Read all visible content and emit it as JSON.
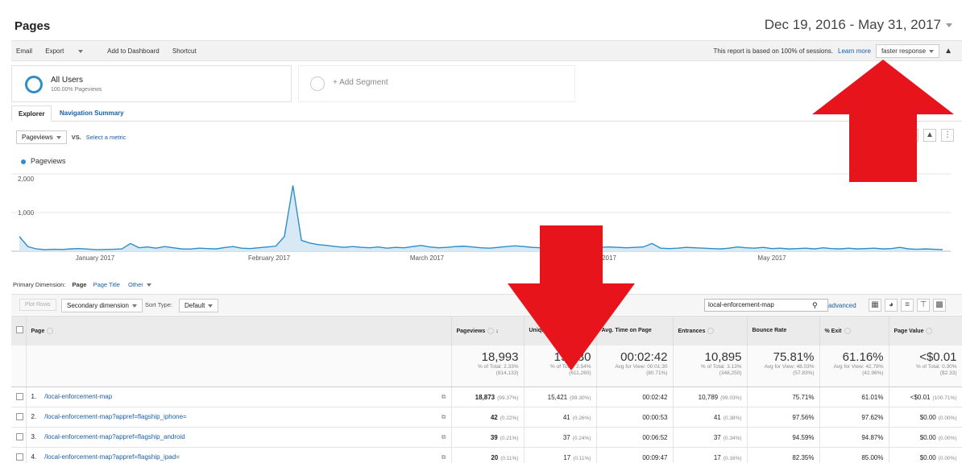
{
  "header": {
    "title": "Pages",
    "date_range": "Dec 19, 2016 - May 31, 2017"
  },
  "toolbar": {
    "email": "Email",
    "export": "Export",
    "add_dashboard": "Add to Dashboard",
    "shortcut": "Shortcut",
    "sampling_note": "This report is based on 100% of sessions.",
    "learn_more": "Learn more",
    "response_select": "faster response"
  },
  "segments": {
    "all_users": {
      "name": "All Users",
      "sub": "100.00% Pageviews"
    },
    "add_segment": "+ Add Segment"
  },
  "tabs": {
    "explorer": "Explorer",
    "navigation_summary": "Navigation Summary"
  },
  "metric_bar": {
    "metric": "Pageviews",
    "vs": "VS.",
    "select_metric": "Select a metric"
  },
  "chart_legend": "Pageviews",
  "chart_data": {
    "type": "area",
    "series": [
      {
        "name": "Pageviews",
        "color": "#2f8ec6",
        "values": [
          380,
          120,
          60,
          40,
          50,
          45,
          60,
          70,
          55,
          40,
          45,
          50,
          60,
          200,
          90,
          110,
          80,
          120,
          90,
          60,
          55,
          80,
          70,
          60,
          95,
          120,
          80,
          70,
          90,
          110,
          130,
          380,
          1700,
          280,
          210,
          170,
          150,
          120,
          100,
          120,
          100,
          90,
          110,
          80,
          100,
          90,
          120,
          150,
          110,
          90,
          100,
          120,
          130,
          110,
          90,
          80,
          100,
          120,
          140,
          120,
          100,
          90,
          110,
          130,
          120,
          100,
          80,
          90,
          100,
          110,
          100,
          90,
          100,
          110,
          200,
          80,
          70,
          80,
          100,
          90,
          80,
          70,
          60,
          80,
          110,
          90,
          80,
          100,
          70,
          80,
          60,
          70,
          80,
          60,
          90,
          70,
          60,
          80,
          60,
          70,
          80,
          60,
          70,
          100,
          60,
          50,
          60,
          50,
          40
        ]
      }
    ],
    "ylim": [
      0,
      2000
    ],
    "y_ticks": [
      "2,000",
      "1,000"
    ],
    "x_ticks": [
      "January 2017",
      "February 2017",
      "March 2017",
      "2017",
      "May 2017"
    ]
  },
  "primary_dimension": {
    "label": "Primary Dimension:",
    "current": "Page",
    "page_title": "Page Title",
    "other": "Other"
  },
  "table_controls": {
    "plot_rows": "Plot Rows",
    "secondary_dimension": "Secondary dimension",
    "sort_type_label": "Sort Type:",
    "sort_type": "Default",
    "search_value": "local-enforcement-map",
    "advanced": "advanced"
  },
  "table": {
    "headers": [
      "Page",
      "Pageviews",
      "Unique",
      "Avg. Time on Page",
      "Entrances",
      "Bounce Rate",
      "% Exit",
      "Page Value"
    ],
    "totals": [
      {
        "value": "18,993",
        "sub": "% of Total: 2.33%",
        "sub2": "(814,133)"
      },
      {
        "value": "15,530",
        "sub": "% of Total: 2.54%",
        "sub2": "(611,260)"
      },
      {
        "value": "00:02:42",
        "sub": "Avg for View: 00:01:30",
        "sub2": "(80.71%)"
      },
      {
        "value": "10,895",
        "sub": "% of Total: 3.13%",
        "sub2": "(348,250)"
      },
      {
        "value": "75.81%",
        "sub": "Avg for View: 48.03%",
        "sub2": "(57.83%)"
      },
      {
        "value": "61.16%",
        "sub": "Avg for View: 42.78%",
        "sub2": "(42.96%)"
      },
      {
        "value": "<$0.01",
        "sub": "% of Total: 0.30%",
        "sub2": "($2.33)"
      }
    ],
    "rows": [
      {
        "idx": "1.",
        "page": "/local-enforcement-map",
        "pv": "18,873",
        "pvp": "(99.37%)",
        "u": "15,421",
        "up": "(99.30%)",
        "t": "00:02:42",
        "e": "10,789",
        "ep": "(99.03%)",
        "b": "75.71%",
        "x": "61.01%",
        "v": "<$0.01",
        "vp": "(100.71%)"
      },
      {
        "idx": "2.",
        "page": "/local-enforcement-map?appref=flagship_iphone=",
        "pv": "42",
        "pvp": "(0.22%)",
        "u": "41",
        "up": "(0.26%)",
        "t": "00:00:53",
        "e": "41",
        "ep": "(0.38%)",
        "b": "97.56%",
        "x": "97.62%",
        "v": "$0.00",
        "vp": "(0.00%)"
      },
      {
        "idx": "3.",
        "page": "/local-enforcement-map?appref=flagship_android",
        "pv": "39",
        "pvp": "(0.21%)",
        "u": "37",
        "up": "(0.24%)",
        "t": "00:06:52",
        "e": "37",
        "ep": "(0.34%)",
        "b": "94.59%",
        "x": "94.87%",
        "v": "$0.00",
        "vp": "(0.00%)"
      },
      {
        "idx": "4.",
        "page": "/local-enforcement-map?appref=flagship_ipad=",
        "pv": "20",
        "pvp": "(0.11%)",
        "u": "17",
        "up": "(0.11%)",
        "t": "00:09:47",
        "e": "17",
        "ep": "(0.16%)",
        "b": "82.35%",
        "x": "85.00%",
        "v": "$0.00",
        "vp": "(0.00%)"
      }
    ]
  },
  "annotations": {
    "arrow_color": "#e8141b"
  }
}
